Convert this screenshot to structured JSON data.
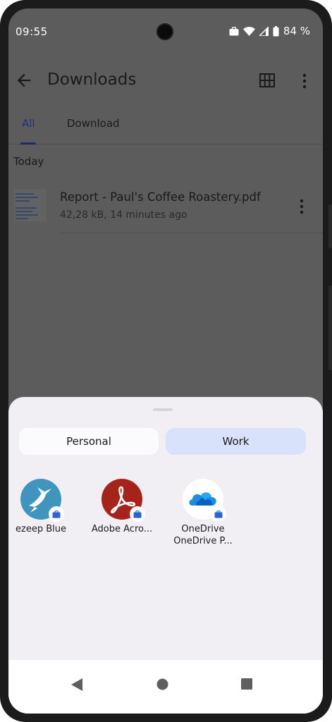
{
  "status_bar": {
    "time": "09:55",
    "battery_percent": "84 %",
    "icons": [
      "work-briefcase-icon",
      "wifi-icon",
      "cell-signal-icon",
      "battery-icon"
    ]
  },
  "app_bar": {
    "title": "Downloads",
    "icons": [
      "back-arrow-icon",
      "grid-view-icon",
      "more-vert-icon"
    ]
  },
  "tabs": [
    {
      "label": "All",
      "selected": true
    },
    {
      "label": "Download",
      "selected": false
    }
  ],
  "section_label": "Today",
  "files": [
    {
      "name": "Report - Paul's Coffee Roastery.pdf",
      "meta": "42,28 kB, 14 minutes ago"
    }
  ],
  "share_sheet": {
    "profiles": [
      {
        "label": "Personal",
        "selected": false
      },
      {
        "label": "Work",
        "selected": true
      }
    ],
    "apps": [
      {
        "label": "ezeep Blue",
        "sublabel": "",
        "icon": "ezeep-hummingbird-icon",
        "color": "#3f95be"
      },
      {
        "label": "Adobe Acro...",
        "sublabel": "",
        "icon": "adobe-acrobat-icon",
        "color": "#a6231c"
      },
      {
        "label": "OneDrive",
        "sublabel": "OneDrive P...",
        "icon": "onedrive-cloud-icon",
        "color": "#ffffff"
      }
    ]
  },
  "nav_bar": {
    "icons": [
      "nav-back-icon",
      "nav-home-icon",
      "nav-recents-icon"
    ]
  },
  "colors": {
    "scrim": "#5c5c5c",
    "sheet": "#f1eff4",
    "work_selected": "#d9e2fb",
    "badge_blue": "#2a63d6"
  }
}
